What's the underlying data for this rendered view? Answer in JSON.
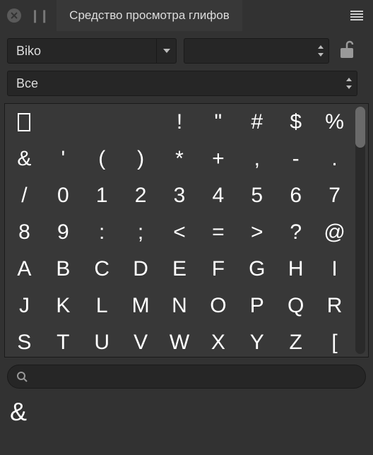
{
  "title_tab": "Средство просмотра глифов",
  "font_select": {
    "value": "Biko"
  },
  "style_select": {
    "value": ""
  },
  "category_select": {
    "value": "Все"
  },
  "search": {
    "placeholder": "",
    "value": ""
  },
  "chart_data": {
    "type": "table",
    "title": "Glyph grid",
    "columns": 9,
    "cells": [
      "",
      "",
      "",
      "",
      "!",
      "\"",
      "#",
      "$",
      "%",
      "&",
      "'",
      "(",
      ")",
      "*",
      "+",
      ",",
      "-",
      ".",
      "/",
      "0",
      "1",
      "2",
      "3",
      "4",
      "5",
      "6",
      "7",
      "8",
      "9",
      ":",
      ";",
      "<",
      "=",
      ">",
      "?",
      "@",
      "A",
      "B",
      "C",
      "D",
      "E",
      "F",
      "G",
      "H",
      "I",
      "J",
      "K",
      "L",
      "M",
      "N",
      "O",
      "P",
      "Q",
      "R",
      "S",
      "T",
      "U",
      "V",
      "W",
      "X",
      "Y",
      "Z",
      "["
    ]
  },
  "preview_glyph": "&",
  "colors": {
    "bg": "#323232",
    "panel": "#383838",
    "input_bg": "#262626",
    "text": "#dddddd",
    "glyph": "#ffffff"
  }
}
